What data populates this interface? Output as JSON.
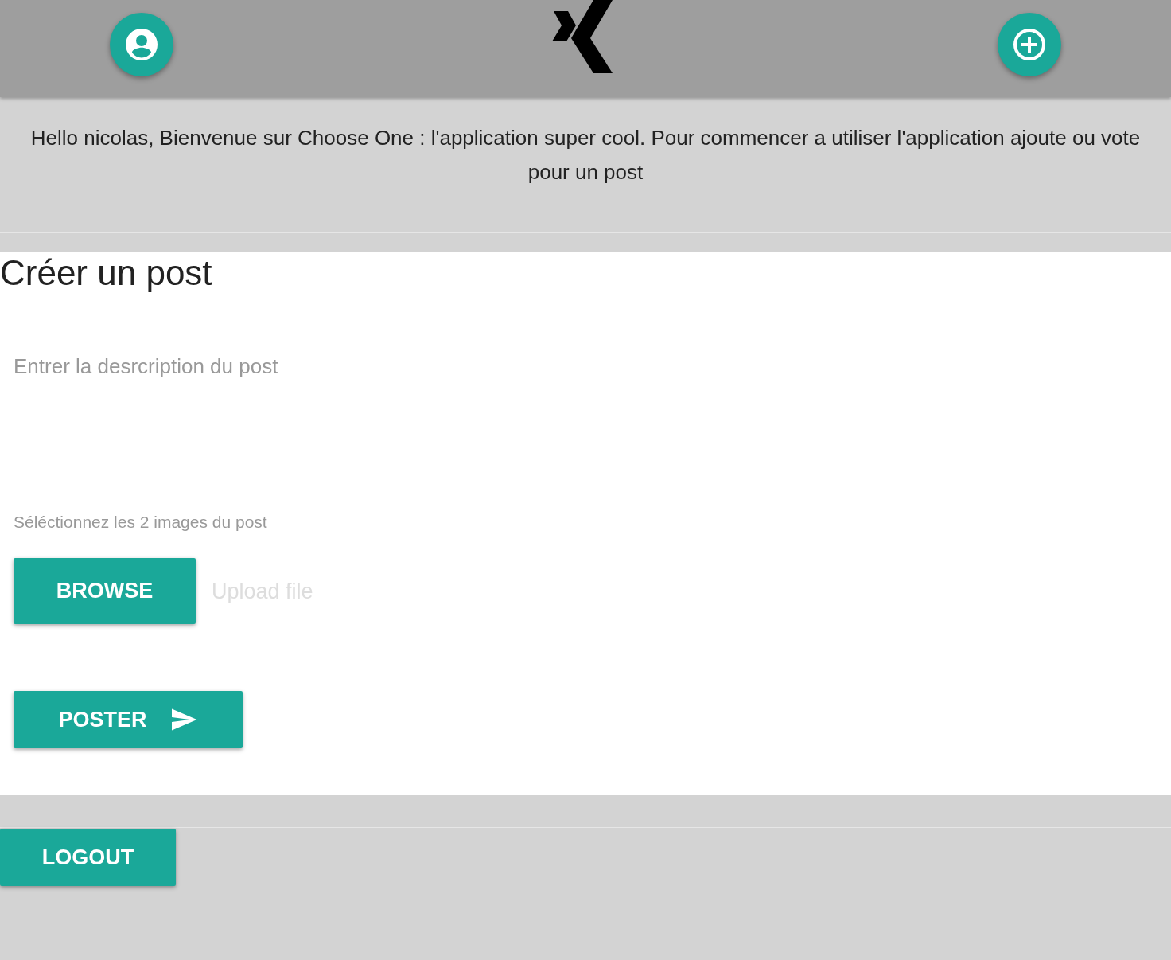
{
  "header": {
    "left_button": {
      "kind": "account"
    },
    "right_button": {
      "kind": "add"
    }
  },
  "welcome": "Hello nicolas, Bienvenue sur Choose One : l'application super cool. Pour commencer a utiliser l'application ajoute ou vote pour un post",
  "form": {
    "title": "Créer un post",
    "description": {
      "placeholder": "Entrer la desrcription du post"
    },
    "images_label": "Séléctionnez les 2 images du post",
    "browse_button": "BROWSE",
    "upload": {
      "placeholder": "Upload file"
    },
    "submit_button": "POSTER"
  },
  "logout_button": "LOGOUT"
}
